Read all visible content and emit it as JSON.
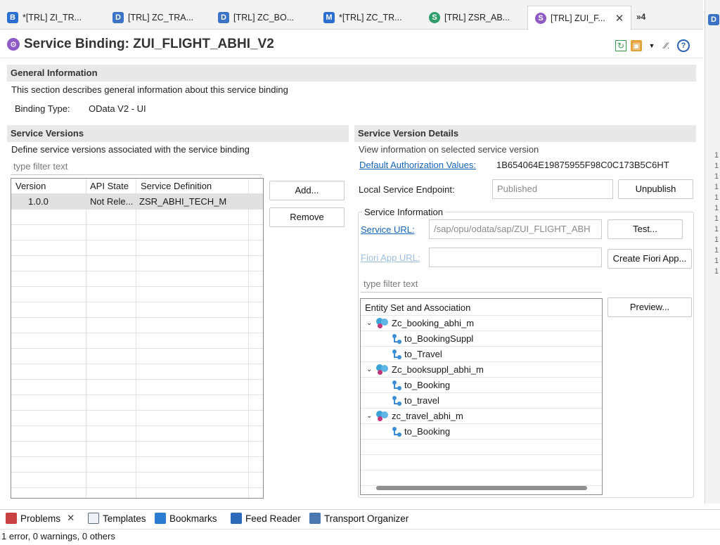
{
  "tabs": [
    {
      "label": "*[TRL] ZI_TR...",
      "icon": "behavior-definition-icon"
    },
    {
      "label": "[TRL] ZC_TRA...",
      "icon": "data-definition-icon"
    },
    {
      "label": "[TRL] ZC_BO...",
      "icon": "data-definition-icon"
    },
    {
      "label": "*[TRL] ZC_TR...",
      "icon": "metadata-extension-icon"
    },
    {
      "label": "[TRL] ZSR_AB...",
      "icon": "service-definition-icon"
    },
    {
      "label": "[TRL] ZUI_F...",
      "icon": "service-binding-icon"
    }
  ],
  "tab_overflow": "»4",
  "editor": {
    "title": "Service Binding: ZUI_FLIGHT_ABHI_V2"
  },
  "general": {
    "heading": "General Information",
    "description": "This section describes general information about this service binding",
    "binding_type_label": "Binding Type:",
    "binding_type_value": "OData V2 - UI"
  },
  "versions": {
    "heading": "Service Versions",
    "description": "Define service versions associated with the service binding",
    "filter_placeholder": "type filter text",
    "columns": [
      "Version",
      "API State",
      "Service Definition"
    ],
    "rows": [
      {
        "version": "1.0.0",
        "api_state": "Not Rele...",
        "service_definition": "ZSR_ABHI_TECH_M"
      }
    ],
    "add_label": "Add...",
    "remove_label": "Remove"
  },
  "details": {
    "heading": "Service Version Details",
    "description": "View information on selected service version",
    "auth_link": "Default Authorization Values:",
    "auth_value": "1B654064E19875955F98C0C173B5C6HT",
    "endpoint_label": "Local Service Endpoint:",
    "endpoint_value": "Published",
    "unpublish_label": "Unpublish",
    "service_info_label": "Service Information",
    "service_url_link": "Service URL:",
    "service_url_value": "/sap/opu/odata/sap/ZUI_FLIGHT_ABH",
    "test_label": "Test...",
    "fiori_link": "Fiori App URL:",
    "fiori_value": "",
    "create_fiori_label": "Create Fiori App...",
    "filter_placeholder": "type filter text",
    "preview_label": "Preview...",
    "tree_header": "Entity Set and Association",
    "tree": [
      {
        "label": "Zc_booking_abhi_m",
        "kind": "entity"
      },
      {
        "label": "to_BookingSuppl",
        "kind": "association"
      },
      {
        "label": "to_Travel",
        "kind": "association"
      },
      {
        "label": "Zc_booksuppl_abhi_m",
        "kind": "entity"
      },
      {
        "label": "to_Booking",
        "kind": "association"
      },
      {
        "label": "to_travel",
        "kind": "association"
      },
      {
        "label": "zc_travel_abhi_m",
        "kind": "entity"
      },
      {
        "label": "to_Booking",
        "kind": "association"
      }
    ]
  },
  "side_line_numbers": [
    "1",
    "1",
    "1",
    "1",
    "1",
    "1",
    "1",
    "1",
    "1",
    "1",
    "1",
    "1"
  ],
  "bottom_views": [
    {
      "label": "Problems",
      "icon": "problems-icon"
    },
    {
      "label": "Templates",
      "icon": "templates-icon"
    },
    {
      "label": "Bookmarks",
      "icon": "bookmarks-icon"
    },
    {
      "label": "Feed Reader",
      "icon": "feed-reader-icon"
    },
    {
      "label": "Transport Organizer",
      "icon": "transport-organizer-icon"
    }
  ],
  "status": "1 error, 0 warnings, 0 others",
  "colors": {
    "link": "#1565c0",
    "section_bg": "#e8e8e8",
    "service_binding": "#8e5bc4"
  }
}
